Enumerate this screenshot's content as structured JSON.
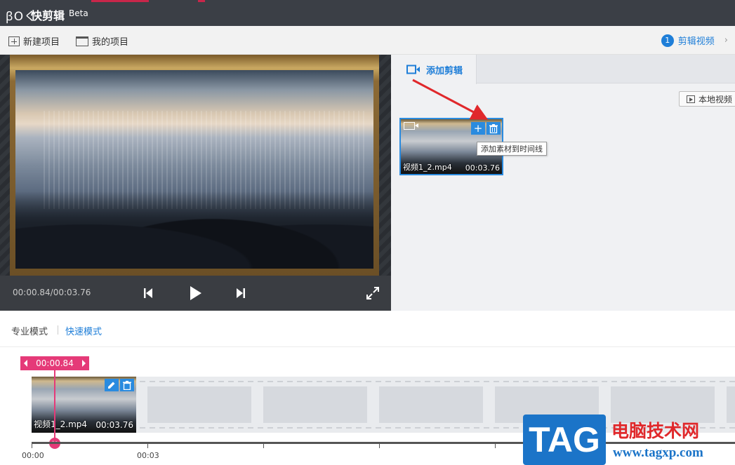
{
  "app": {
    "logo_text": "ꞵOく",
    "name": "快剪辑",
    "edition": "Beta"
  },
  "toolbar": {
    "new_project": "新建项目",
    "my_projects": "我的项目"
  },
  "steps": {
    "current_number": "1",
    "current_label": "剪辑视频"
  },
  "player": {
    "time": "00:00.84/00:03.76"
  },
  "panel": {
    "active_tab": "添加剪辑",
    "local_video_button": "本地视频",
    "media": [
      {
        "name": "视频1_2.mp4",
        "duration": "00:03.76",
        "tooltip": "添加素材到时间线"
      }
    ]
  },
  "modes": {
    "pro": "专业模式",
    "quick": "快速模式",
    "active": "quick"
  },
  "timeline": {
    "playhead_time": "00:00.84",
    "clips": [
      {
        "name": "视频1_2.mp4",
        "duration": "00:03.76"
      }
    ],
    "ticks": [
      "00:00",
      "00:03"
    ]
  },
  "watermark": {
    "badge": "TAG",
    "site_name": "电脑技术网",
    "url": "www.tagxp.com"
  },
  "colors": {
    "accent": "#1e7ed8",
    "playhead": "#e53a78",
    "annotation_arrow": "#e0282b"
  }
}
